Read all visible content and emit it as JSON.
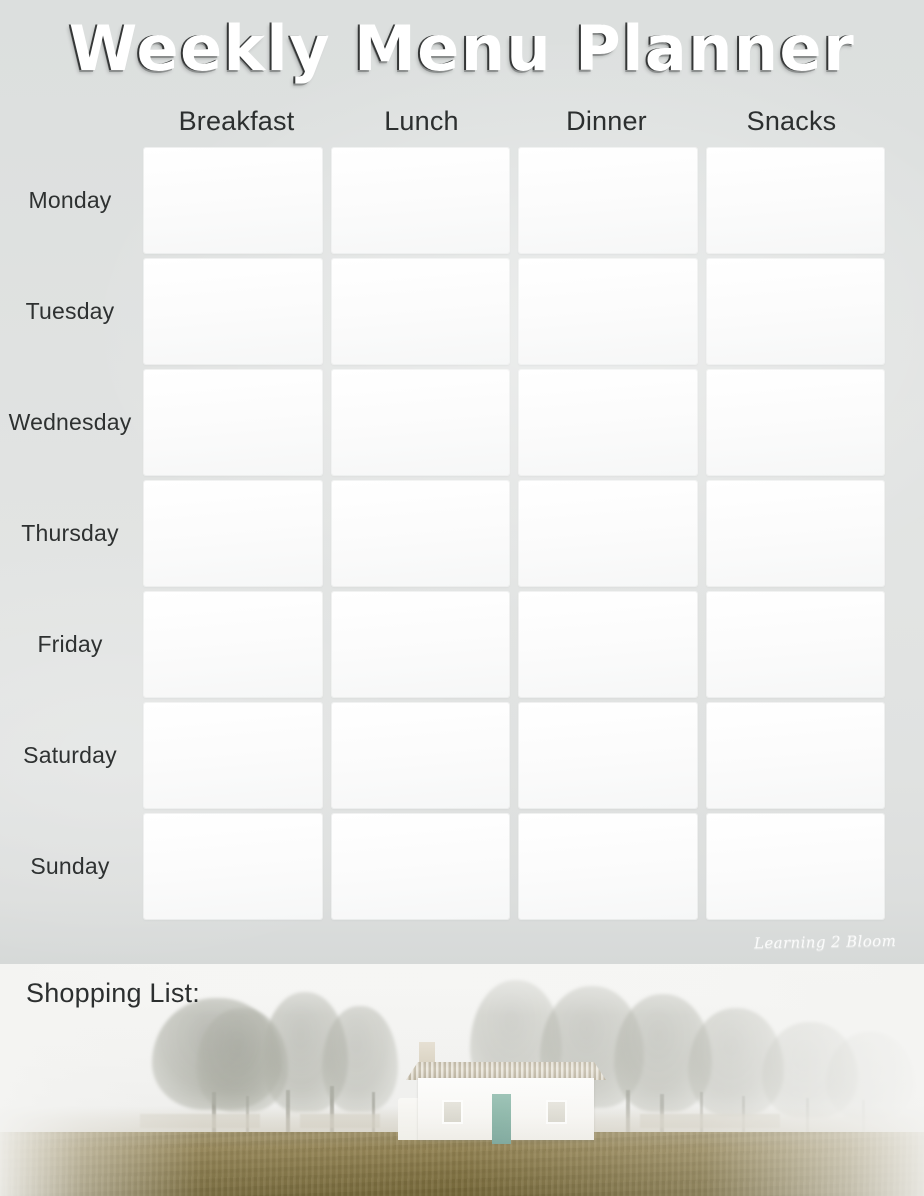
{
  "page": {
    "title": "Weekly Menu Planner",
    "background_color": "#dcdfde",
    "cell_color": "#fbfbfb"
  },
  "planner": {
    "meal_columns": [
      "Breakfast",
      "Lunch",
      "Dinner",
      "Snacks"
    ],
    "days": [
      "Monday",
      "Tuesday",
      "Wednesday",
      "Thursday",
      "Friday",
      "Saturday",
      "Sunday"
    ],
    "cells": [
      [
        "",
        "",
        "",
        ""
      ],
      [
        "",
        "",
        "",
        ""
      ],
      [
        "",
        "",
        "",
        ""
      ],
      [
        "",
        "",
        "",
        ""
      ],
      [
        "",
        "",
        "",
        ""
      ],
      [
        "",
        "",
        "",
        ""
      ],
      [
        "",
        "",
        "",
        ""
      ]
    ]
  },
  "watermark": {
    "text": "Learning 2 Bloom"
  },
  "shopping": {
    "heading": "Shopping List:"
  },
  "photo": {
    "description": "foggy rural landscape with white farmhouse and poplar trees",
    "house_door_color": "#89b4a6",
    "roof_color": "#ddd6c4",
    "field_color": "#8b7a47",
    "tree_color": "#a3a59a",
    "sky_color": "#f4f4f2"
  }
}
